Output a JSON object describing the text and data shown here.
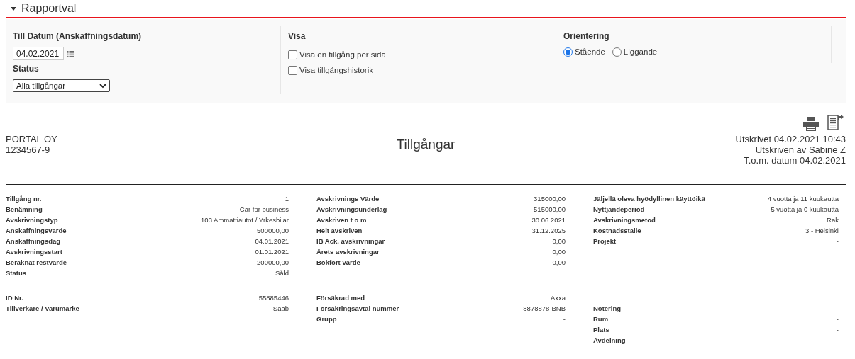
{
  "section": {
    "title": "Rapportval",
    "expanded": true
  },
  "filters": {
    "date": {
      "label": "Till Datum (Anskaffningsdatum)",
      "value": "04.02.2021"
    },
    "status": {
      "label": "Status",
      "value": "Alla tillgångar"
    },
    "show": {
      "label": "Visa",
      "options": [
        {
          "label": "Visa en tillgång per sida",
          "checked": false
        },
        {
          "label": "Visa tillgångshistorik",
          "checked": false
        }
      ]
    },
    "orientation": {
      "label": "Orientering",
      "options": [
        {
          "label": "Stående",
          "selected": true
        },
        {
          "label": "Liggande",
          "selected": false
        }
      ]
    }
  },
  "report": {
    "company": "PORTAL OY",
    "company_id": "1234567-9",
    "title": "Tillgångar",
    "meta": [
      "Utskrivet 04.02.2021 10:43",
      "Utskriven av Sabine Z",
      "T.o.m. datum 04.02.2021"
    ]
  },
  "sections": [
    {
      "rows": [
        [
          {
            "label": "Tillgång nr.",
            "value": "1"
          },
          {
            "label": "Avskrivnings Värde",
            "value": "315000,00"
          },
          {
            "label": "Jäljellä oleva hyödyllinen käyttöikä",
            "value": "4 vuotta ja 11 kuukautta"
          }
        ],
        [
          {
            "label": "Benämning",
            "value": "Car for business"
          },
          {
            "label": "Avskrivningsunderlag",
            "value": "515000,00"
          },
          {
            "label": "Nyttjandeperiod",
            "value": "5 vuotta ja 0 kuukautta"
          }
        ],
        [
          {
            "label": "Avskrivningstyp",
            "value": "103 Ammattiautot / Yrkesbilar"
          },
          {
            "label": "Avskriven t o m",
            "value": "30.06.2021"
          },
          {
            "label": "Avskrivningsmetod",
            "value": "Rak"
          }
        ],
        [
          {
            "label": "Anskaffningsvärde",
            "value": "500000,00"
          },
          {
            "label": "Helt avskriven",
            "value": "31.12.2025"
          },
          {
            "label": "Kostnadsställe",
            "value": "3 - Helsinki"
          }
        ],
        [
          {
            "label": "Anskaffningsdag",
            "value": "04.01.2021"
          },
          {
            "label": "IB Ack. avskrivningar",
            "value": "0,00"
          },
          {
            "label": "Projekt",
            "value": "-"
          }
        ],
        [
          {
            "label": "Avskrivningsstart",
            "value": "01.01.2021"
          },
          {
            "label": "Årets avskrivningar",
            "value": "0,00"
          },
          null
        ],
        [
          {
            "label": "Beräknat restvärde",
            "value": "200000,00"
          },
          {
            "label": "Bokfört värde",
            "value": "0,00"
          },
          null
        ],
        [
          {
            "label": "Status",
            "value": "Såld"
          },
          null,
          null
        ]
      ]
    },
    {
      "rows": [
        [
          {
            "label": "ID Nr.",
            "value": "55885446"
          },
          {
            "label": "Försäkrad med",
            "value": "Axxa"
          },
          null
        ],
        [
          {
            "label": "Tillverkare / Varumärke",
            "value": "Saab"
          },
          {
            "label": "Försäkringsavtal nummer",
            "value": "8878878-BNB"
          },
          {
            "label": "Notering",
            "value": "-"
          }
        ],
        [
          null,
          {
            "label": "Grupp",
            "value": "-"
          },
          {
            "label": "Rum",
            "value": "-"
          }
        ],
        [
          null,
          null,
          {
            "label": "Plats",
            "value": "-"
          }
        ],
        [
          null,
          null,
          {
            "label": "Avdelning",
            "value": "-"
          }
        ]
      ]
    }
  ]
}
